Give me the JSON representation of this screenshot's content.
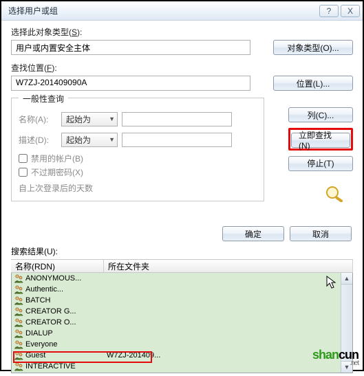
{
  "window": {
    "title": "选择用户或组"
  },
  "section1": {
    "typelabel_pre": "选择此对象类型(",
    "typelabel_u": "S",
    "typelabel_post": "):",
    "typevalue": "用户或内置安全主体",
    "btn_types": "对象类型(O)..."
  },
  "section2": {
    "loclabel_pre": "查找位置(",
    "loclabel_u": "F",
    "loclabel_post": "):",
    "locvalue": "W7ZJ-201409090A",
    "btn_loc": "位置(L)..."
  },
  "groupbox": {
    "legend": "一般性查询",
    "name_label": "名称(A):",
    "name_combo": "起始为",
    "desc_label": "描述(D):",
    "desc_combo": "起始为",
    "chk1": "禁用的帐户(B)",
    "chk2": "不过期密码(X)",
    "lastlogin": "自上次登录后的天数"
  },
  "sidebuttons": {
    "columns": "列(C)...",
    "findnow": "立即查找(N)",
    "stop": "停止(T)"
  },
  "footer": {
    "ok": "确定",
    "cancel": "取消"
  },
  "results": {
    "label": "搜索结果(U):",
    "col1": "名称(RDN)",
    "col2": "所在文件夹",
    "rows": [
      {
        "name": "ANONYMOUS...",
        "folder": ""
      },
      {
        "name": "Authentic...",
        "folder": ""
      },
      {
        "name": "BATCH",
        "folder": ""
      },
      {
        "name": "CREATOR G...",
        "folder": ""
      },
      {
        "name": "CREATOR O...",
        "folder": ""
      },
      {
        "name": "DIALUP",
        "folder": ""
      },
      {
        "name": "Everyone",
        "folder": ""
      },
      {
        "name": "Guest",
        "folder": "W7ZJ-201409..."
      },
      {
        "name": "INTERACTIVE",
        "folder": ""
      }
    ]
  },
  "watermark": {
    "t1": "shan",
    "t2": "cun",
    "net": ".net"
  }
}
